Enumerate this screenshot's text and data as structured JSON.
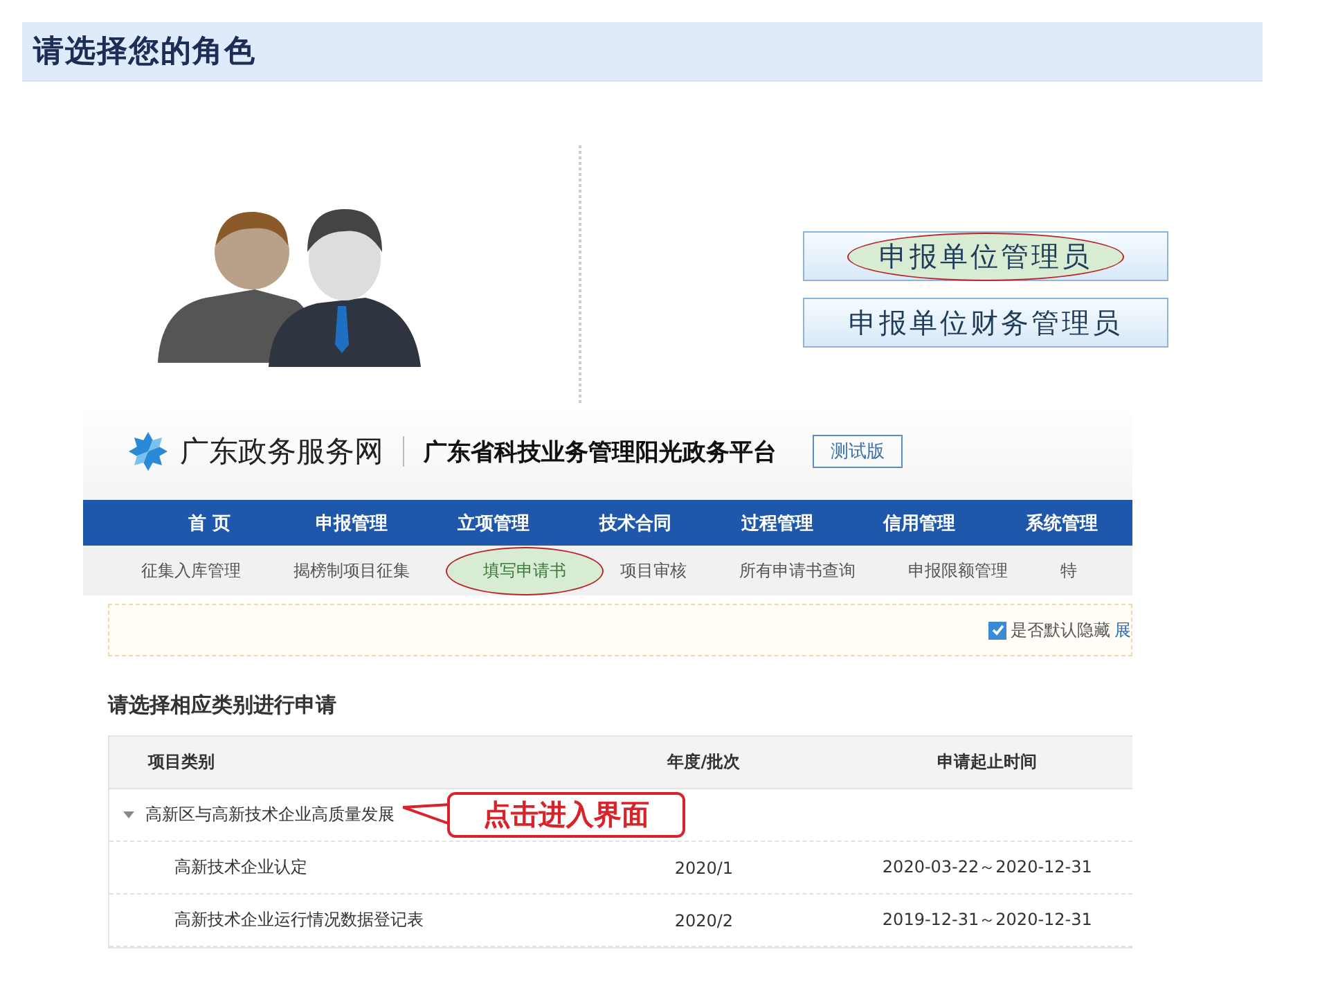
{
  "role_panel": {
    "title": "请选择您的角色",
    "roles": [
      {
        "label": "申报单位管理员",
        "selected": true
      },
      {
        "label": "申报单位财务管理员",
        "selected": false
      }
    ]
  },
  "portal": {
    "site_name": "广东政务服务网",
    "platform_name": "广东省科技业务管理阳光政务平台",
    "badge": "测试版",
    "nav": [
      "首 页",
      "申报管理",
      "立项管理",
      "技术合同",
      "过程管理",
      "信用管理",
      "系统管理"
    ],
    "subnav": [
      {
        "label": "征集入库管理",
        "selected": false
      },
      {
        "label": "揭榜制项目征集",
        "selected": false
      },
      {
        "label": "填写申请书",
        "selected": true
      },
      {
        "label": "项目审核",
        "selected": false
      },
      {
        "label": "所有申请书查询",
        "selected": false
      },
      {
        "label": "申报限额管理",
        "selected": false
      },
      {
        "label": "特",
        "selected": false
      }
    ],
    "notice": {
      "label": "是否默认隐藏",
      "checked": true,
      "link": "展"
    },
    "section_title": "请选择相应类别进行申请",
    "table": {
      "columns": [
        "项目类别",
        "年度/批次",
        "申请起止时间"
      ],
      "groups": [
        {
          "name": "高新区与高新技术企业高质量发展",
          "expanded": true,
          "children": [
            {
              "name": "高新技术企业认定",
              "batch": "2020/1",
              "period": "2020-03-22～2020-12-31"
            },
            {
              "name": "高新技术企业运行情况数据登记表",
              "batch": "2020/2",
              "period": "2019-12-31～2020-12-31"
            }
          ]
        }
      ]
    },
    "callout": {
      "text": "点击进入界面"
    }
  }
}
